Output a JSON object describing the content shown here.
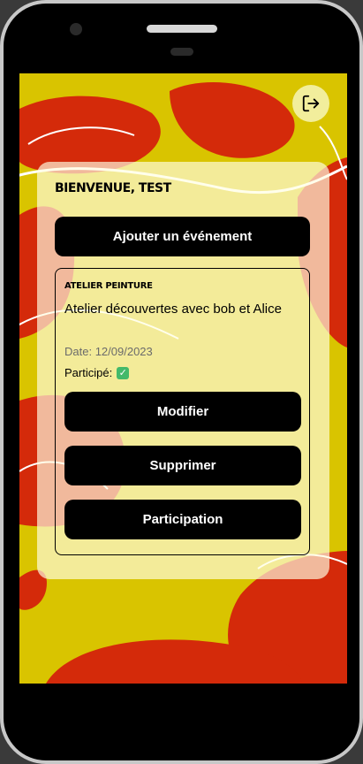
{
  "header": {
    "welcome": "Bienvenue, test"
  },
  "icons": {
    "logout": "logout-icon",
    "check": "check-box-icon"
  },
  "actions": {
    "add_event_label": "Ajouter un événement"
  },
  "event": {
    "title": "Atelier peinture",
    "description": "Atelier découvertes avec bob et Alice",
    "date_label": "Date:",
    "date_value": "12/09/2023",
    "participated_label": "Participé:",
    "participated_value": "✓",
    "modify_label": "Modifier",
    "delete_label": "Supprimer",
    "participate_label": "Participation"
  },
  "colors": {
    "background_yellow": "#d9c400",
    "background_red": "#d42a0a",
    "button": "#000000",
    "check_green": "#43b96a"
  }
}
